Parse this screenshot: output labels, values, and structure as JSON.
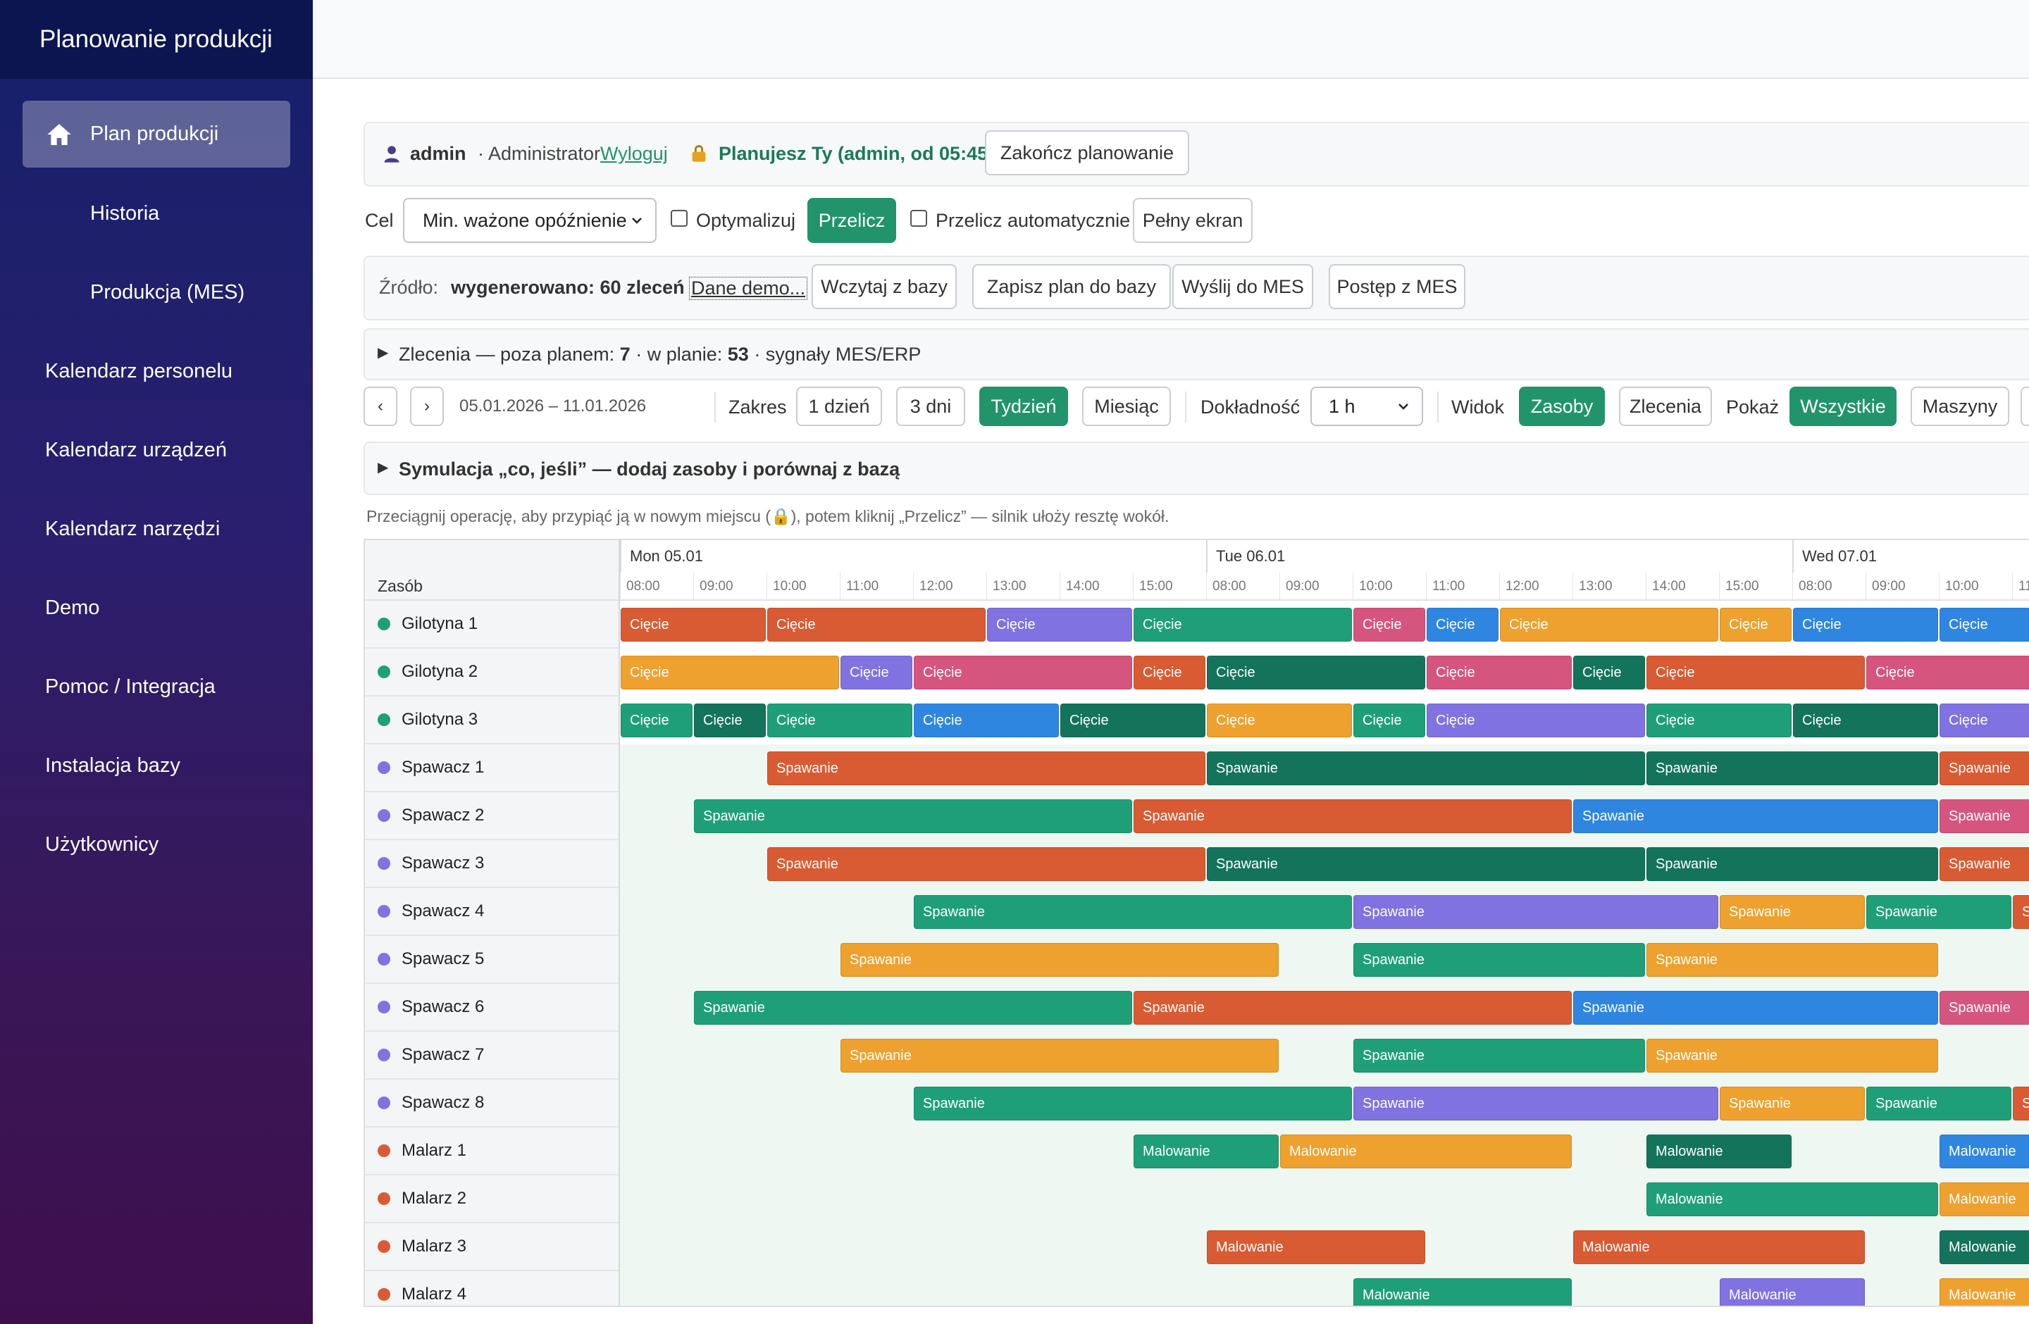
{
  "app": {
    "title": "Planowanie produkcji"
  },
  "sidebar": {
    "items": [
      {
        "label": "Plan produkcji",
        "active": true,
        "icon": "home-icon"
      },
      {
        "label": "Historia"
      },
      {
        "label": "Produkcja (MES)"
      },
      {
        "label": "Kalendarz personelu"
      },
      {
        "label": "Kalendarz urządzeń"
      },
      {
        "label": "Kalendarz narzędzi"
      },
      {
        "label": "Demo"
      },
      {
        "label": "Pomoc / Integracja"
      },
      {
        "label": "Instalacja bazy"
      },
      {
        "label": "Użytkownicy"
      }
    ]
  },
  "session": {
    "user": "admin",
    "role": "· Administrator",
    "logout": "Wyloguj",
    "planning_status": "Planujesz Ty (admin, od 05:45)",
    "end_planning": "Zakończ planowanie"
  },
  "controls": {
    "goal_label": "Cel",
    "goal_value": "Min. ważone opóźnienie",
    "optimize_label": "Optymalizuj",
    "recalc": "Przelicz",
    "auto_recalc_label": "Przelicz automatycznie",
    "fullscreen": "Pełny ekran"
  },
  "source": {
    "label": "Źródło:",
    "value": "wygenerowano: 60 zleceń",
    "demo_link": "Dane demo...",
    "load_db": "Wczytaj z bazy",
    "save_db": "Zapisz plan do bazy",
    "send_mes": "Wyślij do MES",
    "progress_mes": "Postęp z MES"
  },
  "orders": {
    "prefix": "Zlecenia — poza planem: ",
    "out_of_plan": "7",
    "mid": " · w planie: ",
    "in_plan": "53",
    "suffix": " · sygnały MES/ERP"
  },
  "range": {
    "prev": "‹",
    "next": "›",
    "dates": "05.01.2026 – 11.01.2026",
    "range_label": "Zakres",
    "r1": "1 dzień",
    "r3": "3 dni",
    "rweek": "Tydzień",
    "rmonth": "Miesiąc",
    "precision_label": "Dokładność",
    "precision_value": "1 h",
    "view_label": "Widok",
    "view_resources": "Zasoby",
    "view_orders": "Zlecenia",
    "show_label": "Pokaż",
    "show_all": "Wszystkie",
    "show_machines": "Maszyny"
  },
  "simulation": {
    "label": "Symulacja „co, jeśli” — dodaj zasoby i porównaj z bazą"
  },
  "hint": "Przeciągnij operację, aby przypiąć ją w nowym miejscu (🔒), potem kliknij „Przelicz” — silnik ułoży resztę wokół.",
  "gantt": {
    "resource_header": "Zasób",
    "days": [
      "Mon 05.01",
      "Tue 06.01",
      "Wed 07.01"
    ],
    "hours": [
      "08:00",
      "09:00",
      "10:00",
      "11:00",
      "12:00",
      "13:00",
      "14:00",
      "15:00",
      "08:00",
      "09:00",
      "10:00",
      "11:00",
      "12:00",
      "13:00",
      "14:00",
      "15:00",
      "08:00",
      "09:00",
      "10:00",
      "11"
    ],
    "colors": {
      "orange": "#d95b33",
      "purple": "#8072e0",
      "teal": "#1f9f78",
      "pink": "#d6557e",
      "blue": "#2f86e0",
      "amber": "#eea12e",
      "darkgreen": "#14735b",
      "dot_green": "#1f9f78",
      "dot_purple": "#8072e0",
      "dot_orange": "#d95b33"
    },
    "rows": [
      {
        "name": "Gilotyna 1",
        "dot": "dot_green",
        "bars": [
          {
            "s": 0,
            "e": 2,
            "c": "orange",
            "t": "Cięcie"
          },
          {
            "s": 2,
            "e": 5,
            "c": "orange",
            "t": "Cięcie"
          },
          {
            "s": 5,
            "e": 7,
            "c": "purple",
            "t": "Cięcie"
          },
          {
            "s": 7,
            "e": 10,
            "c": "teal",
            "t": "Cięcie"
          },
          {
            "s": 10,
            "e": 11,
            "c": "pink",
            "t": "Cięcie"
          },
          {
            "s": 11,
            "e": 12,
            "c": "blue",
            "t": "Cięcie"
          },
          {
            "s": 12,
            "e": 15,
            "c": "amber",
            "t": "Cięcie"
          },
          {
            "s": 15,
            "e": 16,
            "c": "amber",
            "t": "Cięcie"
          },
          {
            "s": 16,
            "e": 18,
            "c": "blue",
            "t": "Cięcie"
          },
          {
            "s": 18,
            "e": 20,
            "c": "blue",
            "t": "Cięcie"
          }
        ]
      },
      {
        "name": "Gilotyna 2",
        "dot": "dot_green",
        "bars": [
          {
            "s": 0,
            "e": 3,
            "c": "amber",
            "t": "Cięcie"
          },
          {
            "s": 3,
            "e": 4,
            "c": "purple",
            "t": "Cięcie"
          },
          {
            "s": 4,
            "e": 7,
            "c": "pink",
            "t": "Cięcie"
          },
          {
            "s": 7,
            "e": 8,
            "c": "orange",
            "t": "Cięcie"
          },
          {
            "s": 8,
            "e": 11,
            "c": "darkgreen",
            "t": "Cięcie"
          },
          {
            "s": 11,
            "e": 13,
            "c": "pink",
            "t": "Cięcie"
          },
          {
            "s": 13,
            "e": 14,
            "c": "darkgreen",
            "t": "Cięcie"
          },
          {
            "s": 14,
            "e": 17,
            "c": "orange",
            "t": "Cięcie"
          },
          {
            "s": 17,
            "e": 20,
            "c": "pink",
            "t": "Cięcie"
          }
        ]
      },
      {
        "name": "Gilotyna 3",
        "dot": "dot_green",
        "bars": [
          {
            "s": 0,
            "e": 1,
            "c": "teal",
            "t": "Cięcie"
          },
          {
            "s": 1,
            "e": 2,
            "c": "darkgreen",
            "t": "Cięcie"
          },
          {
            "s": 2,
            "e": 4,
            "c": "teal",
            "t": "Cięcie"
          },
          {
            "s": 4,
            "e": 6,
            "c": "blue",
            "t": "Cięcie"
          },
          {
            "s": 6,
            "e": 8,
            "c": "darkgreen",
            "t": "Cięcie"
          },
          {
            "s": 8,
            "e": 10,
            "c": "amber",
            "t": "Cięcie"
          },
          {
            "s": 10,
            "e": 11,
            "c": "teal",
            "t": "Cięcie"
          },
          {
            "s": 11,
            "e": 14,
            "c": "purple",
            "t": "Cięcie"
          },
          {
            "s": 14,
            "e": 16,
            "c": "teal",
            "t": "Cięcie"
          },
          {
            "s": 16,
            "e": 18,
            "c": "darkgreen",
            "t": "Cięcie"
          },
          {
            "s": 18,
            "e": 20,
            "c": "purple",
            "t": "Cięcie"
          }
        ]
      },
      {
        "name": "Spawacz 1",
        "dot": "dot_purple",
        "bars": [
          {
            "s": 2,
            "e": 8,
            "c": "orange",
            "t": "Spawanie"
          },
          {
            "s": 8,
            "e": 14,
            "c": "darkgreen",
            "t": "Spawanie"
          },
          {
            "s": 14,
            "e": 18,
            "c": "darkgreen",
            "t": "Spawanie"
          },
          {
            "s": 18,
            "e": 20,
            "c": "orange",
            "t": "Spawanie"
          }
        ]
      },
      {
        "name": "Spawacz 2",
        "dot": "dot_purple",
        "bars": [
          {
            "s": 1,
            "e": 7,
            "c": "teal",
            "t": "Spawanie"
          },
          {
            "s": 7,
            "e": 13,
            "c": "orange",
            "t": "Spawanie"
          },
          {
            "s": 13,
            "e": 18,
            "c": "blue",
            "t": "Spawanie"
          },
          {
            "s": 18,
            "e": 20,
            "c": "pink",
            "t": "Spawanie"
          }
        ]
      },
      {
        "name": "Spawacz 3",
        "dot": "dot_purple",
        "bars": [
          {
            "s": 2,
            "e": 8,
            "c": "orange",
            "t": "Spawanie"
          },
          {
            "s": 8,
            "e": 14,
            "c": "darkgreen",
            "t": "Spawanie"
          },
          {
            "s": 14,
            "e": 18,
            "c": "darkgreen",
            "t": "Spawanie"
          },
          {
            "s": 18,
            "e": 20,
            "c": "orange",
            "t": "Spawanie"
          }
        ]
      },
      {
        "name": "Spawacz 4",
        "dot": "dot_purple",
        "bars": [
          {
            "s": 4,
            "e": 10,
            "c": "teal",
            "t": "Spawanie"
          },
          {
            "s": 10,
            "e": 15,
            "c": "purple",
            "t": "Spawanie"
          },
          {
            "s": 15,
            "e": 17,
            "c": "amber",
            "t": "Spawanie"
          },
          {
            "s": 17,
            "e": 19,
            "c": "teal",
            "t": "Spawanie"
          },
          {
            "s": 19,
            "e": 20,
            "c": "orange",
            "t": "Sp"
          }
        ]
      },
      {
        "name": "Spawacz 5",
        "dot": "dot_purple",
        "bars": [
          {
            "s": 3,
            "e": 9,
            "c": "amber",
            "t": "Spawanie"
          },
          {
            "s": 10,
            "e": 14,
            "c": "teal",
            "t": "Spawanie"
          },
          {
            "s": 14,
            "e": 18,
            "c": "amber",
            "t": "Spawanie"
          }
        ]
      },
      {
        "name": "Spawacz 6",
        "dot": "dot_purple",
        "bars": [
          {
            "s": 1,
            "e": 7,
            "c": "teal",
            "t": "Spawanie"
          },
          {
            "s": 7,
            "e": 13,
            "c": "orange",
            "t": "Spawanie"
          },
          {
            "s": 13,
            "e": 18,
            "c": "blue",
            "t": "Spawanie"
          },
          {
            "s": 18,
            "e": 20,
            "c": "pink",
            "t": "Spawanie"
          }
        ]
      },
      {
        "name": "Spawacz 7",
        "dot": "dot_purple",
        "bars": [
          {
            "s": 3,
            "e": 9,
            "c": "amber",
            "t": "Spawanie"
          },
          {
            "s": 10,
            "e": 14,
            "c": "teal",
            "t": "Spawanie"
          },
          {
            "s": 14,
            "e": 18,
            "c": "amber",
            "t": "Spawanie"
          }
        ]
      },
      {
        "name": "Spawacz 8",
        "dot": "dot_purple",
        "bars": [
          {
            "s": 4,
            "e": 10,
            "c": "teal",
            "t": "Spawanie"
          },
          {
            "s": 10,
            "e": 15,
            "c": "purple",
            "t": "Spawanie"
          },
          {
            "s": 15,
            "e": 17,
            "c": "amber",
            "t": "Spawanie"
          },
          {
            "s": 17,
            "e": 19,
            "c": "teal",
            "t": "Spawanie"
          },
          {
            "s": 19,
            "e": 20,
            "c": "orange",
            "t": "Sp"
          }
        ]
      },
      {
        "name": "Malarz 1",
        "dot": "dot_orange",
        "bars": [
          {
            "s": 7,
            "e": 9,
            "c": "teal",
            "t": "Malowanie"
          },
          {
            "s": 9,
            "e": 13,
            "c": "amber",
            "t": "Malowanie"
          },
          {
            "s": 14,
            "e": 16,
            "c": "darkgreen",
            "t": "Malowanie"
          },
          {
            "s": 18,
            "e": 20,
            "c": "blue",
            "t": "Malowanie"
          }
        ]
      },
      {
        "name": "Malarz 2",
        "dot": "dot_orange",
        "bars": [
          {
            "s": 14,
            "e": 18,
            "c": "teal",
            "t": "Malowanie"
          },
          {
            "s": 18,
            "e": 20,
            "c": "amber",
            "t": "Malowanie"
          }
        ]
      },
      {
        "name": "Malarz 3",
        "dot": "dot_orange",
        "bars": [
          {
            "s": 8,
            "e": 11,
            "c": "orange",
            "t": "Malowanie"
          },
          {
            "s": 13,
            "e": 17,
            "c": "orange",
            "t": "Malowanie"
          },
          {
            "s": 18,
            "e": 20,
            "c": "darkgreen",
            "t": "Malowanie"
          }
        ]
      },
      {
        "name": "Malarz 4",
        "dot": "dot_orange",
        "bars": [
          {
            "s": 10,
            "e": 13,
            "c": "teal",
            "t": "Malowanie"
          },
          {
            "s": 15,
            "e": 17,
            "c": "purple",
            "t": "Malowanie"
          },
          {
            "s": 18,
            "e": 20,
            "c": "amber",
            "t": "Malowanie"
          }
        ]
      }
    ]
  }
}
